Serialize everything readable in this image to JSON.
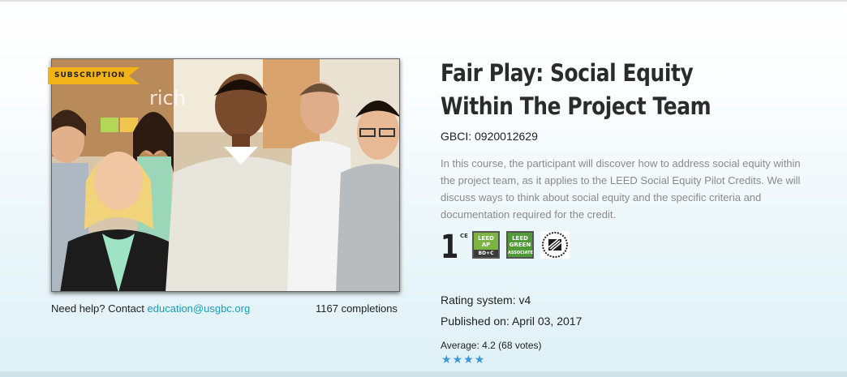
{
  "course": {
    "badge": "SUBSCRIPTION",
    "title": "Fair Play: Social Equity Within The Project Team",
    "gbci": "GBCI: 0920012629",
    "description": "In this course, the participant will discover how to address social equity within the project team, as it applies to the LEED Social Equity Pilot Credits. We will discuss ways to think about social equity and the specific criteria and documentation required for the credit.",
    "image_text": "rich",
    "image_icon": "group-photo"
  },
  "help": {
    "prefix": "Need help? Contact ",
    "email": "education@usgbc.org"
  },
  "completions": "1167 completions",
  "credits": {
    "ce_hours": "1",
    "ce_label": "CE",
    "badges": [
      {
        "name": "leed-ap-bdc-badge",
        "line1": "LEED",
        "line2": "AP",
        "sub": "BD+C",
        "color": "#7cb342"
      },
      {
        "name": "leed-green-associate-badge",
        "line1": "LEED",
        "line2": "GREEN",
        "sub": "ASSOCIATE",
        "color": "#4f9a37"
      }
    ],
    "cert_icon": "certification-seal-icon"
  },
  "details": {
    "rating_system": "Rating system: v4",
    "published": "Published on: April 03, 2017",
    "average": "Average: 4.2 (68 votes)",
    "rating_value": 4.2,
    "rating_max": 5
  },
  "colors": {
    "accent": "#1a9bb8",
    "badge": "#f2b318",
    "star": "#3a98d6"
  }
}
